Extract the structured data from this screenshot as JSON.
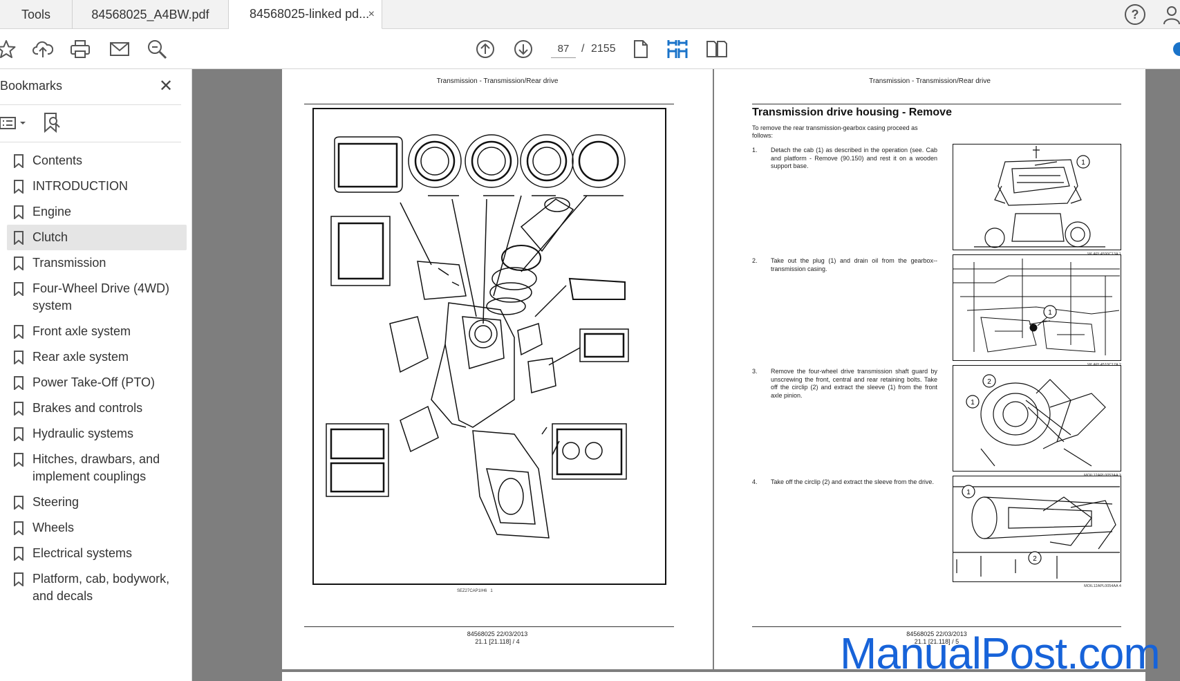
{
  "tabs": {
    "tools": "Tools",
    "doc1": "84568025_A4BW.pdf",
    "doc2": "84568025-linked pd...",
    "close": "×"
  },
  "help": "?",
  "toolbar": {
    "page_current": "87",
    "page_sep": "/",
    "page_total": "2155"
  },
  "sidebar": {
    "title": "Bookmarks",
    "close": "✕",
    "items": [
      {
        "label": "Contents"
      },
      {
        "label": "INTRODUCTION"
      },
      {
        "label": "Engine"
      },
      {
        "label": "Clutch"
      },
      {
        "label": "Transmission"
      },
      {
        "label": "Four-Wheel Drive (4WD) system"
      },
      {
        "label": "Front axle system"
      },
      {
        "label": "Rear axle system"
      },
      {
        "label": "Power Take-Off (PTO)"
      },
      {
        "label": "Brakes and controls"
      },
      {
        "label": "Hydraulic systems"
      },
      {
        "label": "Hitches, drawbars, and implement couplings"
      },
      {
        "label": "Steering"
      },
      {
        "label": "Wheels"
      },
      {
        "label": "Electrical systems"
      },
      {
        "label": "Platform, cab, bodywork, and decals"
      }
    ]
  },
  "left_page": {
    "header": "Transmission - Transmission/Rear drive",
    "figure_code": "SEZ27CAP1IH6",
    "figure_num": "1",
    "footer_line1": "84568025 22/03/2013",
    "footer_line2": "21.1 [21.118] / 4"
  },
  "right_page": {
    "header": "Transmission - Transmission/Rear drive",
    "title": "Transmission drive housing - Remove",
    "intro": "To remove the rear transmission-gearbox casing proceed as follows:",
    "steps": [
      {
        "num": "1.",
        "text": "Detach the cab (1) as described in the operation (see. Cab and platform - Remove (90.150) and rest it on a wooden support base.",
        "caption": "WLAPL4590C13A   1",
        "callouts": [
          "1"
        ]
      },
      {
        "num": "2.",
        "text": "Take out the plug (1) and drain oil from the gearbox--transmission casing.",
        "caption": "WLAPL4510C17A   2",
        "callouts": [
          "1"
        ]
      },
      {
        "num": "3.",
        "text": "Remove the four-wheel drive transmission shaft guard by unscrewing the front, central and rear retaining bolts. Take off the circlip (2) and extract the sleeve (1) from the front axle pinion.",
        "caption": "MOIL12APL0053AA   3",
        "callouts": [
          "1",
          "2"
        ]
      },
      {
        "num": "4.",
        "text": "Take off the circlip (2) and extract the sleeve from the drive.",
        "caption": "MOIL12APL0054AA   4",
        "callouts": [
          "1",
          "2"
        ]
      }
    ],
    "footer_line1": "84568025 22/03/2013",
    "footer_line2": "21.1 [21.118] / 5"
  },
  "watermark": "ManualPost.com"
}
